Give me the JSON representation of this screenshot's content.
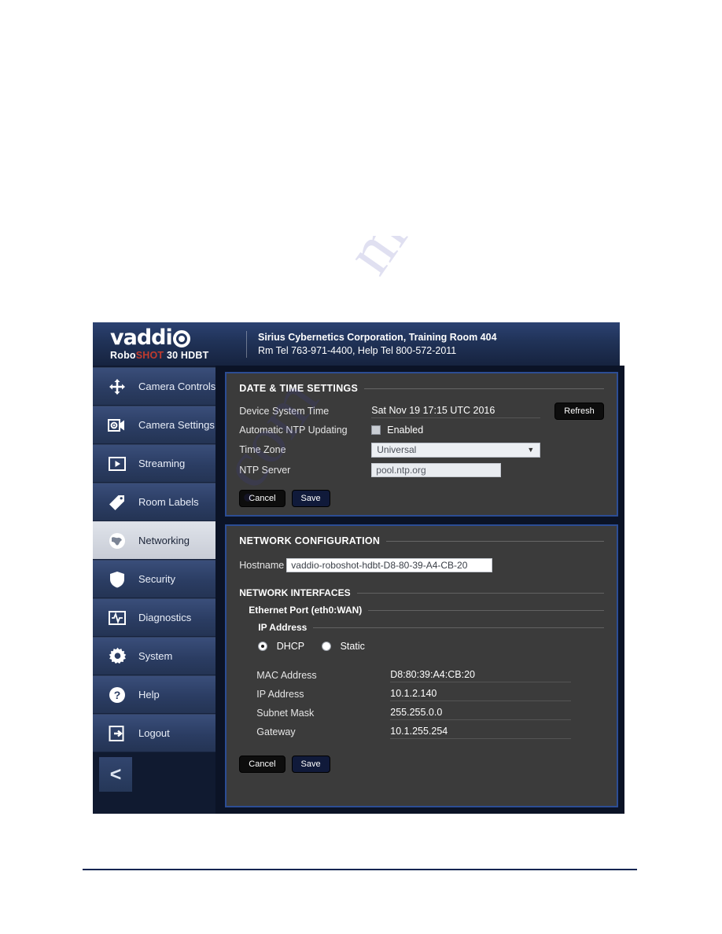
{
  "watermark": {
    "line1": "manualshelve",
    "line2": ".com"
  },
  "app": {
    "brand": {
      "wordmark_a": "vaddi",
      "wordmark_b": "o",
      "model_pre": "Robo",
      "model_red": "SHOT",
      "model_post": " 30 HDBT"
    },
    "header": {
      "line1": "Sirius Cybernetics Corporation, Training Room 404",
      "line2": "Rm Tel 763-971-4400, Help Tel 800-572-2011"
    },
    "sidebar": {
      "items": [
        {
          "label": "Camera Controls",
          "icon": "move-arrows-icon",
          "selected": false
        },
        {
          "label": "Camera Settings",
          "icon": "camera-gear-icon",
          "selected": false
        },
        {
          "label": "Streaming",
          "icon": "play-screen-icon",
          "selected": false
        },
        {
          "label": "Room Labels",
          "icon": "tag-icon",
          "selected": false
        },
        {
          "label": "Networking",
          "icon": "globe-icon",
          "selected": true
        },
        {
          "label": "Security",
          "icon": "shield-icon",
          "selected": false
        },
        {
          "label": "Diagnostics",
          "icon": "pulse-icon",
          "selected": false
        },
        {
          "label": "System",
          "icon": "gear-icon",
          "selected": false
        },
        {
          "label": "Help",
          "icon": "question-circle-icon",
          "selected": false
        },
        {
          "label": "Logout",
          "icon": "exit-door-icon",
          "selected": false
        }
      ],
      "collapse_label": "<"
    },
    "date_time_panel": {
      "title": "DATE & TIME SETTINGS",
      "device_system_time_label": "Device System Time",
      "device_system_time_value": "Sat Nov 19 17:15 UTC 2016",
      "refresh_label": "Refresh",
      "ntp_auto_label": "Automatic NTP Updating",
      "ntp_enabled_label": "Enabled",
      "ntp_enabled_checked": false,
      "time_zone_label": "Time Zone",
      "time_zone_value": "Universal",
      "time_zone_caret": "▼",
      "ntp_server_label": "NTP Server",
      "ntp_server_value": "pool.ntp.org",
      "cancel_label": "Cancel",
      "save_label": "Save"
    },
    "network_panel": {
      "title": "NETWORK CONFIGURATION",
      "hostname_label": "Hostname",
      "hostname_value": "vaddio-roboshot-hdbt-D8-80-39-A4-CB-20",
      "interfaces_title": "NETWORK INTERFACES",
      "ethernet_title": "Ethernet Port (eth0:WAN)",
      "ip_address_title": "IP Address",
      "dhcp_label": "DHCP",
      "static_label": "Static",
      "dhcp_selected": true,
      "static_selected": false,
      "rows": [
        {
          "label": "MAC Address",
          "value": "D8:80:39:A4:CB:20"
        },
        {
          "label": "IP Address",
          "value": "10.1.2.140"
        },
        {
          "label": "Subnet Mask",
          "value": "255.255.0.0"
        },
        {
          "label": "Gateway",
          "value": "10.1.255.254"
        }
      ],
      "cancel_label": "Cancel",
      "save_label": "Save"
    }
  },
  "colors": {
    "header_blue": "#203257",
    "panel_border": "#2c4d94",
    "panel_bg": "#3b3b3b",
    "nav_blue": "#2b3d63",
    "selected_nav": "#d4d8e0",
    "rule_blue": "#0d2551"
  }
}
